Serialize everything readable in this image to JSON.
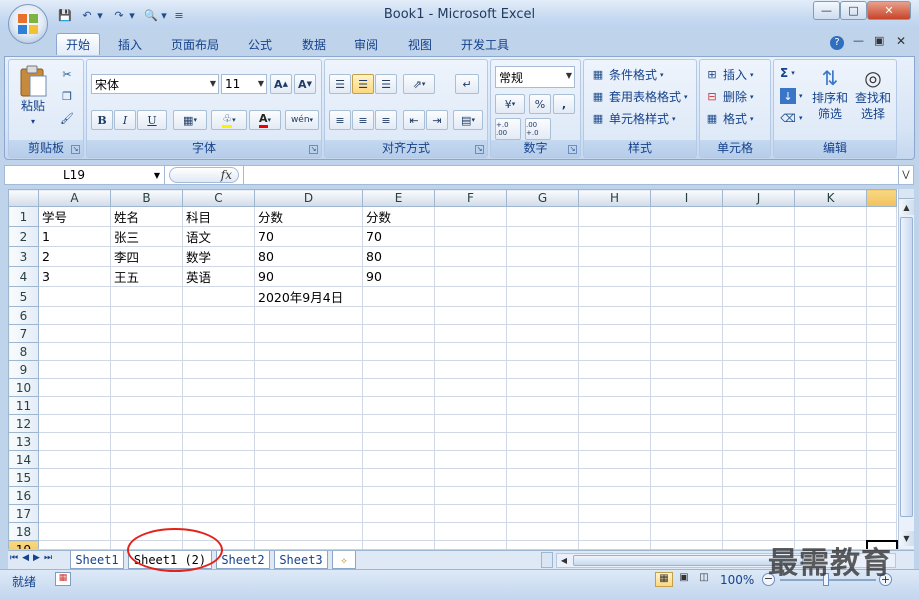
{
  "window": {
    "title": "Book1 - Microsoft Excel"
  },
  "tabs": [
    "开始",
    "插入",
    "页面布局",
    "公式",
    "数据",
    "审阅",
    "视图",
    "开发工具"
  ],
  "active_tab": "开始",
  "ribbon": {
    "clipboard": {
      "label": "剪贴板",
      "paste": "粘贴"
    },
    "font": {
      "label": "字体",
      "name": "宋体",
      "size": "11",
      "bold": "B",
      "italic": "I",
      "underline": "U",
      "font_color_icon": "A",
      "phonetic_icon": "wén"
    },
    "alignment": {
      "label": "对齐方式"
    },
    "number": {
      "label": "数字",
      "format": "常规",
      "percent": "%",
      "comma": ",",
      "inc_decimal": "+.0 .00",
      "dec_decimal": ".00 +.0"
    },
    "styles": {
      "label": "样式",
      "conditional": "条件格式",
      "table_format": "套用表格格式",
      "cell_style": "单元格样式"
    },
    "cells": {
      "label": "单元格",
      "insert": "插入",
      "delete": "删除",
      "format": "格式"
    },
    "editing": {
      "label": "编辑",
      "sum_icon": "Σ",
      "sort": "排序和",
      "sort2": "筛选",
      "find": "查找和",
      "find2": "选择"
    }
  },
  "formula_bar": {
    "name_box": "L19",
    "fx": "fx",
    "value": ""
  },
  "columns": [
    "A",
    "B",
    "C",
    "D",
    "E",
    "F",
    "G",
    "H",
    "I",
    "J",
    "K"
  ],
  "rows": [
    {
      "n": "1",
      "cells": [
        "学号",
        "姓名",
        "科目",
        "分数",
        "分数",
        "",
        "",
        "",
        "",
        "",
        ""
      ]
    },
    {
      "n": "2",
      "cells": [
        "1",
        "张三",
        "语文",
        "70",
        "70",
        "",
        "",
        "",
        "",
        "",
        ""
      ]
    },
    {
      "n": "3",
      "cells": [
        "2",
        "李四",
        "数学",
        "80",
        "80",
        "",
        "",
        "",
        "",
        "",
        ""
      ]
    },
    {
      "n": "4",
      "cells": [
        "3",
        "王五",
        "英语",
        "90",
        "90",
        "",
        "",
        "",
        "",
        "",
        ""
      ]
    },
    {
      "n": "5",
      "cells": [
        "",
        "",
        "",
        "2020年9月4日",
        "",
        "",
        "",
        "",
        "",
        "",
        ""
      ]
    },
    {
      "n": "6",
      "cells": [
        "",
        "",
        "",
        "",
        "",
        "",
        "",
        "",
        "",
        "",
        ""
      ]
    },
    {
      "n": "7",
      "cells": [
        "",
        "",
        "",
        "",
        "",
        "",
        "",
        "",
        "",
        "",
        ""
      ]
    },
    {
      "n": "8",
      "cells": [
        "",
        "",
        "",
        "",
        "",
        "",
        "",
        "",
        "",
        "",
        ""
      ]
    },
    {
      "n": "9",
      "cells": [
        "",
        "",
        "",
        "",
        "",
        "",
        "",
        "",
        "",
        "",
        ""
      ]
    },
    {
      "n": "10",
      "cells": [
        "",
        "",
        "",
        "",
        "",
        "",
        "",
        "",
        "",
        "",
        ""
      ]
    },
    {
      "n": "11",
      "cells": [
        "",
        "",
        "",
        "",
        "",
        "",
        "",
        "",
        "",
        "",
        ""
      ]
    },
    {
      "n": "12",
      "cells": [
        "",
        "",
        "",
        "",
        "",
        "",
        "",
        "",
        "",
        "",
        ""
      ]
    },
    {
      "n": "13",
      "cells": [
        "",
        "",
        "",
        "",
        "",
        "",
        "",
        "",
        "",
        "",
        ""
      ]
    },
    {
      "n": "14",
      "cells": [
        "",
        "",
        "",
        "",
        "",
        "",
        "",
        "",
        "",
        "",
        ""
      ]
    },
    {
      "n": "15",
      "cells": [
        "",
        "",
        "",
        "",
        "",
        "",
        "",
        "",
        "",
        "",
        ""
      ]
    },
    {
      "n": "16",
      "cells": [
        "",
        "",
        "",
        "",
        "",
        "",
        "",
        "",
        "",
        "",
        ""
      ]
    },
    {
      "n": "17",
      "cells": [
        "",
        "",
        "",
        "",
        "",
        "",
        "",
        "",
        "",
        "",
        ""
      ]
    },
    {
      "n": "18",
      "cells": [
        "",
        "",
        "",
        "",
        "",
        "",
        "",
        "",
        "",
        "",
        ""
      ]
    },
    {
      "n": "19",
      "cells": [
        "",
        "",
        "",
        "",
        "",
        "",
        "",
        "",
        "",
        "",
        ""
      ]
    }
  ],
  "selected_row": "19",
  "sheets": [
    "Sheet1",
    "Sheet1 (2)",
    "Sheet2",
    "Sheet3"
  ],
  "active_sheet": "Sheet1 (2)",
  "status": {
    "ready": "就绪",
    "zoom": "100%"
  },
  "watermark": "最需教育"
}
